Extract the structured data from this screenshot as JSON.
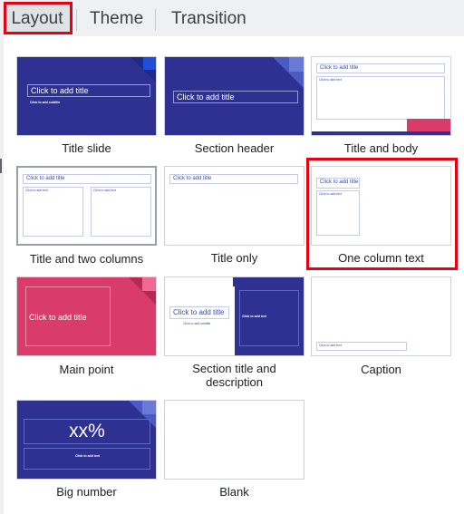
{
  "tabs": [
    {
      "label": "Layout"
    },
    {
      "label": "Theme"
    },
    {
      "label": "Transition"
    }
  ],
  "layouts": [
    {
      "label": "Title slide",
      "title_placeholder": "Click to add title",
      "subtitle_placeholder": "Click to add subtitle"
    },
    {
      "label": "Section header",
      "title_placeholder": "Click to add title"
    },
    {
      "label": "Title and body",
      "title_placeholder": "Click to add title",
      "body_placeholder": "Click to add text"
    },
    {
      "label": "Title and two columns",
      "title_placeholder": "Click to add title",
      "body_placeholder": "Click to add text"
    },
    {
      "label": "Title only",
      "title_placeholder": "Click to add title"
    },
    {
      "label": "One column text",
      "title_placeholder": "Click to add title",
      "body_placeholder": "Click to add text"
    },
    {
      "label": "Main point",
      "title_placeholder": "Click to add title"
    },
    {
      "label": "Section title and description",
      "title_placeholder": "Click to add title",
      "subtitle_placeholder": "Click to add subtitle",
      "body_placeholder": "Click to add text"
    },
    {
      "label": "Caption",
      "body_placeholder": "Click to add text"
    },
    {
      "label": "Big number",
      "number": "xx%",
      "body_placeholder": "Click to add text"
    },
    {
      "label": "Blank"
    }
  ],
  "colors": {
    "navy": "#2e3192",
    "pink": "#d93b6a",
    "highlight": "#e60012"
  }
}
